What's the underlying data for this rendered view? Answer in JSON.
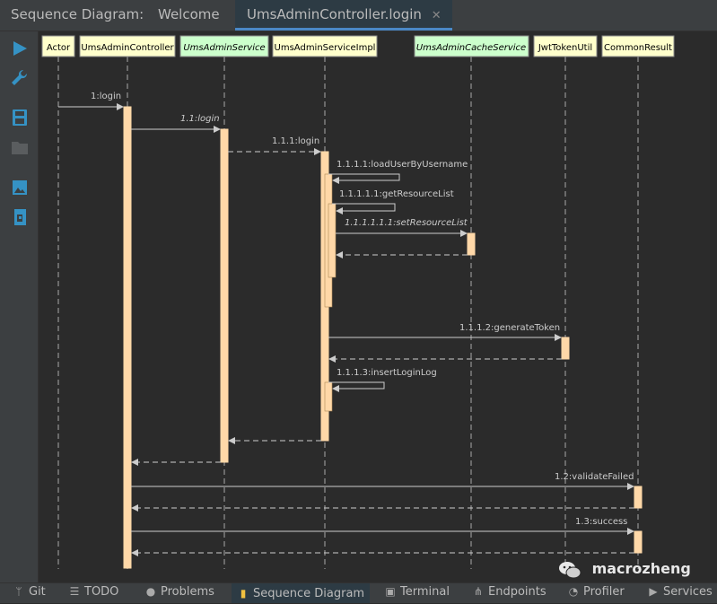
{
  "tab_bar": {
    "title": "Sequence Diagram:",
    "tabs": [
      {
        "label": "Welcome",
        "active": false,
        "close": ""
      },
      {
        "label": "UmsAdminController.login",
        "active": true,
        "close": "✕"
      }
    ]
  },
  "sidebar_icons": [
    "play-icon",
    "wrench-icon",
    "save-icon",
    "folder-icon",
    "image-icon",
    "export-icon"
  ],
  "participants": [
    {
      "label": "Actor",
      "style": "class"
    },
    {
      "label": "UmsAdminController",
      "style": "class"
    },
    {
      "label": "UmsAdminService",
      "style": "interface"
    },
    {
      "label": "UmsAdminServiceImpl",
      "style": "class"
    },
    {
      "label": "UmsAdminCacheService",
      "style": "interface"
    },
    {
      "label": "JwtTokenUtil",
      "style": "class"
    },
    {
      "label": "CommonResult",
      "style": "class"
    }
  ],
  "messages": [
    {
      "label": "1:login",
      "italic": false
    },
    {
      "label": "1.1:login",
      "italic": true
    },
    {
      "label": "1.1.1:login",
      "italic": false
    },
    {
      "label": "1.1.1.1:loadUserByUsername",
      "italic": false
    },
    {
      "label": "1.1.1.1.1:getResourceList",
      "italic": false
    },
    {
      "label": "1.1.1.1.1.1:setResourceList",
      "italic": true
    },
    {
      "label": "1.1.1.2:generateToken",
      "italic": false
    },
    {
      "label": "1.1.1.3:insertLoginLog",
      "italic": false
    },
    {
      "label": "1.2:validateFailed",
      "italic": false
    },
    {
      "label": "1.3:success",
      "italic": false
    }
  ],
  "bottom_bar": [
    {
      "label": "Git",
      "icon": "git-branch-icon",
      "active": false
    },
    {
      "label": "TODO",
      "icon": "list-icon",
      "active": false
    },
    {
      "label": "Problems",
      "icon": "warning-icon",
      "active": false
    },
    {
      "label": "Sequence Diagram",
      "icon": "diagram-icon",
      "active": true
    },
    {
      "label": "Terminal",
      "icon": "terminal-icon",
      "active": false
    },
    {
      "label": "Endpoints",
      "icon": "endpoints-icon",
      "active": false
    },
    {
      "label": "Profiler",
      "icon": "profiler-icon",
      "active": false
    },
    {
      "label": "Services",
      "icon": "services-icon",
      "active": false
    }
  ],
  "watermark": {
    "text": "macrozheng",
    "icon": "wechat-icon"
  },
  "colors": {
    "background": "#2b2b2b",
    "panel": "#3c3f41",
    "class_box": "#ffffcc",
    "interface_box": "#ccffcc",
    "activation": "#ffd8a8",
    "message_line": "#cccccc",
    "accent": "#4a88c7"
  }
}
